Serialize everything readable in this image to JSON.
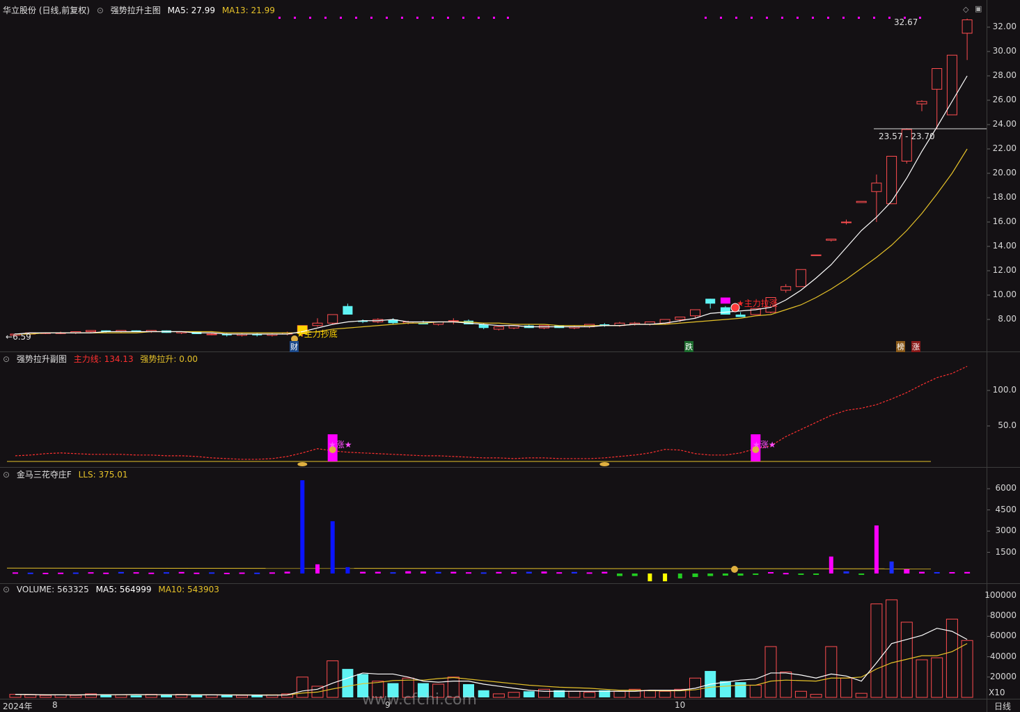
{
  "main": {
    "stock": "华立股份 (日线,前复权)",
    "indicator": "强势拉升主图",
    "ma5_label": "MA5: 27.99",
    "ma13_label": "MA13: 21.99",
    "high_label": "32.67",
    "low_label": "6.59",
    "range_label": "23.57 - 23.70",
    "signal_bottom": "主力抄底",
    "signal_pull": "主力拉涨",
    "tag_cai": "财",
    "tag_die": "跌",
    "tag_bang": "榜",
    "tag_zhang": "涨",
    "yticks": [
      "32.00",
      "30.00",
      "28.00",
      "26.00",
      "24.00",
      "22.00",
      "20.00",
      "18.00",
      "16.00",
      "14.00",
      "12.00",
      "10.00",
      "8.00"
    ]
  },
  "sub1": {
    "title": "强势拉升副图",
    "line1_label": "主力线: 134.13",
    "line2_label": "强势拉升: 0.00",
    "signal": "★涨★",
    "yticks": [
      "100.0",
      "50.0"
    ]
  },
  "sub2": {
    "title": "金马三花夺庄F",
    "value_label": "LLS: 375.01",
    "yticks": [
      "6000",
      "4500",
      "3000",
      "1500"
    ]
  },
  "vol": {
    "value_label": "VOLUME: 563325",
    "ma5_label": "MA5: 564999",
    "ma10_label": "MA10: 543903",
    "unit": "X10",
    "yticks": [
      "100000",
      "80000",
      "60000",
      "40000",
      "20000"
    ]
  },
  "xaxis": {
    "year": "2024年",
    "labels": [
      "8",
      "9",
      "10"
    ],
    "period": "日线"
  },
  "watermark": "www.cfchi.com",
  "colors": {
    "up": "#ff4d4f",
    "down": "#5ff4f4",
    "ma5": "#ffffff",
    "ma13": "#e6c229",
    "main_line": "#ff3030",
    "magenta": "#ff00ff"
  },
  "chart_data": {
    "type": "candlestick",
    "ylim": [
      6,
      33
    ],
    "candles": [
      [
        6.7,
        6.8,
        6.6,
        6.8
      ],
      [
        6.8,
        6.9,
        6.7,
        6.9
      ],
      [
        6.9,
        6.9,
        6.8,
        6.9
      ],
      [
        6.9,
        7.0,
        6.8,
        6.9
      ],
      [
        6.9,
        7.0,
        6.8,
        7.0
      ],
      [
        7.0,
        7.1,
        6.9,
        7.1
      ],
      [
        7.1,
        7.1,
        6.9,
        7.0
      ],
      [
        7.0,
        7.1,
        6.9,
        7.1
      ],
      [
        7.1,
        7.1,
        7.0,
        7.0
      ],
      [
        7.0,
        7.1,
        6.9,
        7.1
      ],
      [
        7.1,
        7.1,
        6.9,
        6.9
      ],
      [
        6.9,
        7.0,
        6.8,
        7.0
      ],
      [
        7.0,
        7.0,
        6.8,
        6.8
      ],
      [
        6.8,
        6.9,
        6.7,
        6.8
      ],
      [
        6.8,
        6.9,
        6.6,
        6.7
      ],
      [
        6.7,
        6.9,
        6.6,
        6.8
      ],
      [
        6.8,
        6.9,
        6.6,
        6.7
      ],
      [
        6.7,
        6.9,
        6.6,
        6.8
      ],
      [
        6.8,
        7.0,
        6.7,
        6.9
      ],
      [
        6.9,
        7.5,
        6.6,
        7.5
      ],
      [
        7.5,
        8.1,
        7.4,
        7.7
      ],
      [
        7.7,
        8.4,
        7.6,
        8.4
      ],
      [
        9.1,
        9.3,
        8.4,
        8.4
      ],
      [
        7.9,
        8.0,
        7.7,
        7.8
      ],
      [
        7.8,
        8.1,
        7.7,
        8.0
      ],
      [
        8.0,
        8.1,
        7.6,
        7.7
      ],
      [
        7.7,
        7.9,
        7.6,
        7.8
      ],
      [
        7.7,
        7.9,
        7.6,
        7.6
      ],
      [
        7.6,
        7.8,
        7.5,
        7.8
      ],
      [
        7.9,
        8.1,
        7.6,
        7.9
      ],
      [
        7.9,
        8.0,
        7.6,
        7.6
      ],
      [
        7.6,
        7.7,
        7.2,
        7.3
      ],
      [
        7.2,
        7.4,
        7.1,
        7.4
      ],
      [
        7.3,
        7.5,
        7.2,
        7.5
      ],
      [
        7.5,
        7.6,
        7.3,
        7.3
      ],
      [
        7.3,
        7.5,
        7.2,
        7.5
      ],
      [
        7.5,
        7.5,
        7.3,
        7.3
      ],
      [
        7.3,
        7.5,
        7.2,
        7.4
      ],
      [
        7.4,
        7.6,
        7.3,
        7.6
      ],
      [
        7.6,
        7.7,
        7.4,
        7.5
      ],
      [
        7.5,
        7.8,
        7.4,
        7.7
      ],
      [
        7.6,
        7.8,
        7.5,
        7.7
      ],
      [
        7.6,
        7.8,
        7.5,
        7.8
      ],
      [
        7.7,
        8.0,
        7.6,
        8.0
      ],
      [
        8.0,
        8.2,
        7.8,
        8.2
      ],
      [
        8.3,
        8.8,
        8.1,
        8.8
      ],
      [
        9.7,
        9.7,
        8.9,
        9.3
      ],
      [
        9.0,
        9.1,
        8.4,
        8.4
      ],
      [
        8.4,
        8.6,
        8.2,
        8.2
      ],
      [
        8.4,
        8.9,
        8.4,
        8.9
      ],
      [
        8.6,
        9.8,
        8.5,
        9.8
      ],
      [
        10.4,
        10.9,
        10.2,
        10.7
      ],
      [
        10.7,
        12.1,
        10.7,
        12.1
      ],
      [
        13.3,
        13.3,
        13.3,
        13.3
      ],
      [
        14.5,
        14.6,
        14.4,
        14.6
      ],
      [
        16.0,
        16.2,
        15.8,
        16.0
      ],
      [
        17.6,
        17.7,
        17.6,
        17.7
      ],
      [
        18.5,
        19.9,
        16.0,
        19.2
      ],
      [
        17.5,
        21.4,
        17.5,
        21.4
      ],
      [
        21.0,
        23.7,
        20.8,
        23.6
      ],
      [
        25.7,
        26.0,
        25.1,
        25.9
      ],
      [
        26.9,
        28.6,
        23.6,
        28.6
      ],
      [
        24.8,
        29.7,
        24.8,
        29.7
      ],
      [
        31.5,
        32.7,
        29.3,
        32.6
      ]
    ],
    "ma5": [
      6.8,
      6.9,
      6.9,
      6.9,
      6.9,
      6.9,
      7.0,
      7.0,
      7.0,
      7.0,
      7.0,
      7.0,
      6.9,
      6.9,
      6.8,
      6.8,
      6.8,
      6.8,
      6.8,
      7.0,
      7.3,
      7.6,
      7.8,
      7.9,
      7.9,
      8.0,
      7.8,
      7.8,
      7.8,
      7.8,
      7.7,
      7.6,
      7.5,
      7.5,
      7.4,
      7.4,
      7.4,
      7.4,
      7.4,
      7.5,
      7.5,
      7.6,
      7.6,
      7.7,
      7.9,
      8.1,
      8.5,
      8.6,
      8.7,
      8.8,
      9.0,
      9.6,
      10.4,
      11.4,
      12.5,
      13.9,
      15.3,
      16.4,
      17.7,
      19.6,
      21.8,
      23.8,
      25.9,
      28.0
    ],
    "ma13": [
      6.8,
      6.8,
      6.9,
      6.9,
      6.9,
      6.9,
      6.9,
      6.9,
      6.9,
      7.0,
      7.0,
      7.0,
      7.0,
      7.0,
      6.9,
      6.9,
      6.9,
      6.9,
      6.9,
      6.9,
      7.0,
      7.2,
      7.3,
      7.4,
      7.5,
      7.6,
      7.7,
      7.7,
      7.8,
      7.8,
      7.8,
      7.7,
      7.7,
      7.6,
      7.6,
      7.6,
      7.5,
      7.5,
      7.5,
      7.5,
      7.5,
      7.6,
      7.6,
      7.6,
      7.7,
      7.8,
      7.9,
      8.0,
      8.1,
      8.3,
      8.4,
      8.8,
      9.2,
      9.8,
      10.5,
      11.3,
      12.2,
      13.1,
      14.1,
      15.3,
      16.7,
      18.3,
      20.0,
      22.0
    ],
    "volume": [
      3000,
      2500,
      2000,
      2500,
      2000,
      3500,
      3000,
      2500,
      2000,
      3000,
      2500,
      3000,
      2000,
      2500,
      2000,
      2000,
      2500,
      2500,
      3500,
      20000,
      11000,
      36000,
      28000,
      23000,
      16000,
      14000,
      19000,
      14000,
      13000,
      20000,
      13000,
      7000,
      3500,
      5000,
      6000,
      8000,
      7000,
      6000,
      5000,
      7000,
      6000,
      8000,
      7000,
      6000,
      8000,
      19000,
      26000,
      16000,
      15000,
      12000,
      50000,
      25000,
      6000,
      3000,
      50000,
      19000,
      4000,
      92000,
      96000,
      74000,
      37000,
      39000,
      77000,
      56000
    ],
    "vol_ma5": [
      3000,
      2800,
      2500,
      2500,
      2400,
      2700,
      2600,
      2700,
      2800,
      2700,
      2700,
      2600,
      2500,
      2500,
      2400,
      2300,
      2300,
      2200,
      2400,
      6300,
      8000,
      14000,
      19000,
      24000,
      23000,
      23000,
      20000,
      16000,
      15000,
      16000,
      16000,
      13000,
      11000,
      9000,
      7000,
      6000,
      6000,
      6000,
      6000,
      6000,
      6000,
      6000,
      7000,
      7000,
      7000,
      9000,
      13000,
      15000,
      17000,
      18000,
      24000,
      24000,
      22000,
      19000,
      23000,
      21000,
      16000,
      34000,
      53000,
      57000,
      61000,
      68000,
      65000,
      57000
    ],
    "vol_ma10": [
      3000,
      2800,
      2600,
      2500,
      2500,
      2600,
      2600,
      2600,
      2600,
      2600,
      2600,
      2600,
      2600,
      2500,
      2500,
      2500,
      2400,
      2400,
      2400,
      4300,
      5200,
      8300,
      11000,
      13500,
      14700,
      16500,
      17000,
      17000,
      18500,
      19500,
      18000,
      16500,
      15000,
      13500,
      12000,
      11000,
      10000,
      9500,
      9000,
      8000,
      7000,
      7000,
      6500,
      6500,
      6500,
      7500,
      10000,
      11000,
      12000,
      12000,
      16000,
      17000,
      16500,
      16000,
      19000,
      19000,
      20000,
      28000,
      34000,
      37500,
      41000,
      41000,
      45000,
      53000
    ],
    "lls": [
      80,
      60,
      50,
      60,
      70,
      90,
      60,
      110,
      90,
      60,
      90,
      110,
      60,
      80,
      50,
      70,
      60,
      80,
      130,
      6600,
      650,
      3700,
      450,
      120,
      120,
      90,
      160,
      140,
      110,
      120,
      90,
      80,
      110,
      90,
      120,
      140,
      90,
      110,
      80,
      120,
      -180,
      -180,
      -550,
      -550,
      -350,
      -250,
      -180,
      -150,
      -150,
      -100,
      100,
      40,
      -60,
      -60,
      1200,
      150,
      -100,
      3400,
      850,
      300,
      120,
      100,
      100,
      110
    ],
    "lls_ma": [
      380
    ],
    "main_line": [
      8,
      9,
      11,
      12,
      11,
      10,
      10,
      10,
      9,
      9,
      8,
      8,
      7,
      5,
      4,
      3,
      3,
      4,
      7,
      12,
      18,
      15,
      13,
      12,
      11,
      10,
      9,
      8,
      8,
      7,
      6,
      5,
      5,
      4,
      5,
      5,
      4,
      4,
      4,
      5,
      7,
      9,
      12,
      17,
      16,
      11,
      9,
      9,
      12,
      18,
      22,
      35,
      45,
      55,
      65,
      72,
      75,
      80,
      88,
      97,
      108,
      118,
      124,
      134
    ]
  }
}
